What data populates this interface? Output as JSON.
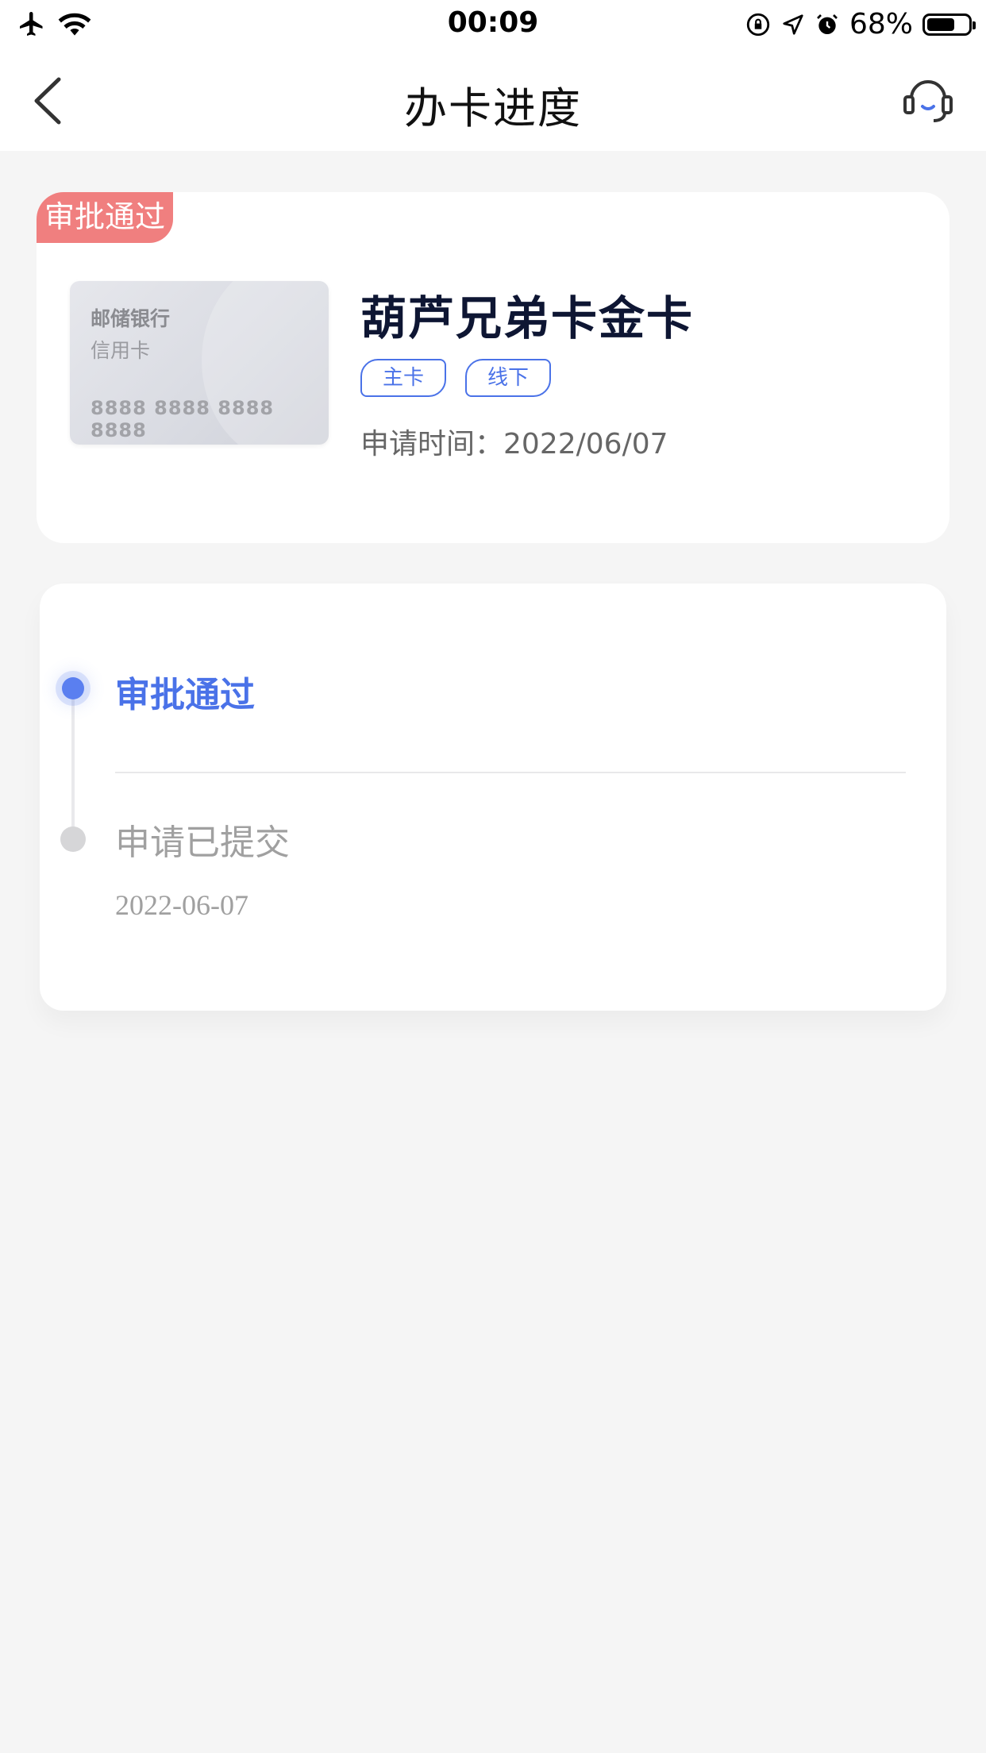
{
  "status_bar": {
    "time": "00:09",
    "battery": "68%",
    "battery_level": 0.68
  },
  "nav": {
    "title": "办卡进度"
  },
  "application": {
    "status_tag": "审批通过",
    "card_image": {
      "bank": "邮储银行",
      "type": "信用卡",
      "number": "8888 8888 8888 8888"
    },
    "card_name": "葫芦兄弟卡金卡",
    "tags": [
      "主卡",
      "线下"
    ],
    "apply_time_label": "申请时间：",
    "apply_time": "2022/06/07"
  },
  "timeline": {
    "steps": [
      {
        "label": "审批通过",
        "date": "",
        "active": true
      },
      {
        "label": "申请已提交",
        "date": "2022-06-07",
        "active": false
      }
    ]
  },
  "colors": {
    "accent": "#4a72e8",
    "status_tag": "#f07f7f",
    "background": "#f5f5f5"
  }
}
